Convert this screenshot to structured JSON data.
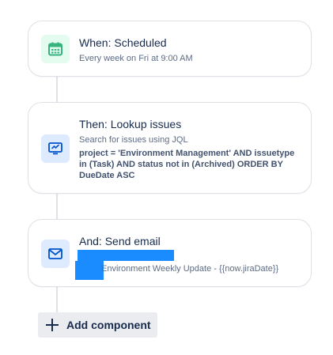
{
  "trigger": {
    "title": "When: Scheduled",
    "subtitle": "Every week on Fri at 9:00 AM",
    "icon": "calendar-icon",
    "color": "#36b37e",
    "bg": "#e3fcef"
  },
  "lookup": {
    "title": "Then: Lookup issues",
    "subtitle": "Search for issues using JQL",
    "jql": "project = 'Environment Management' AND issuetype in (Task) AND status not in (Archived) ORDER BY DueDate ASC",
    "icon": "monitor-search-icon",
    "color": "#0052cc",
    "bg": "#deebff"
  },
  "email": {
    "title": "And: Send email",
    "subject": "Environment Weekly Update - {{now.jiraDate}}",
    "icon": "mail-icon",
    "color": "#0052cc",
    "bg": "#deebff"
  },
  "add_component": {
    "label": "Add component",
    "icon": "plus-icon"
  }
}
